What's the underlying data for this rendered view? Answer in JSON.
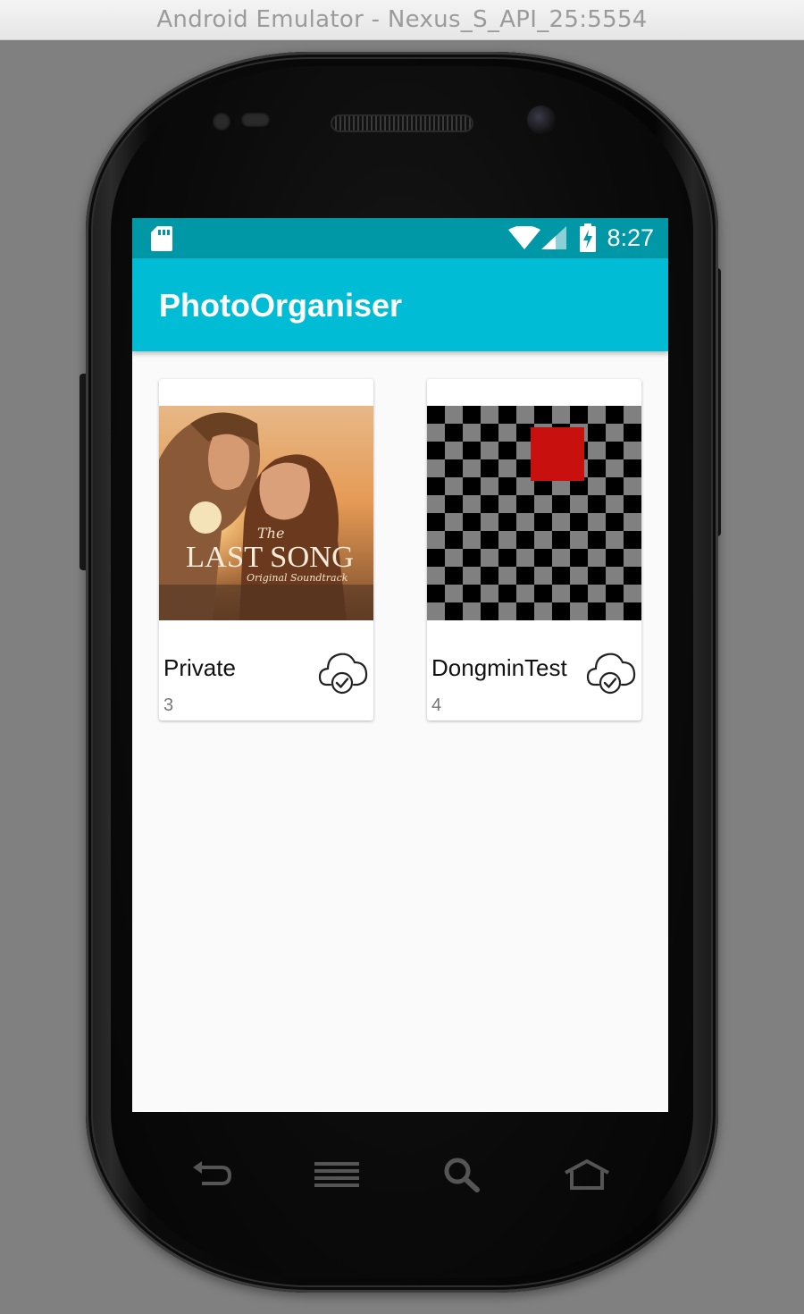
{
  "window": {
    "title": "Android Emulator - Nexus_S_API_25:5554"
  },
  "status_bar": {
    "time": "8:27"
  },
  "app_bar": {
    "title": "PhotoOrganiser"
  },
  "albums": [
    {
      "name": "Private",
      "count": "3",
      "cover": {
        "overlay_small": "The",
        "overlay_title": "LAST SONG",
        "overlay_sub": "Original Soundtrack"
      },
      "sync_icon": "cloud-check-icon"
    },
    {
      "name": "DongminTest",
      "count": "4",
      "cover": {},
      "sync_icon": "cloud-check-icon"
    }
  ],
  "nav_keys": [
    "back-icon",
    "menu-icon",
    "search-icon",
    "home-icon"
  ],
  "colors": {
    "status": "#0097a7",
    "appbar": "#00bcd4",
    "red": "#c8110f"
  }
}
